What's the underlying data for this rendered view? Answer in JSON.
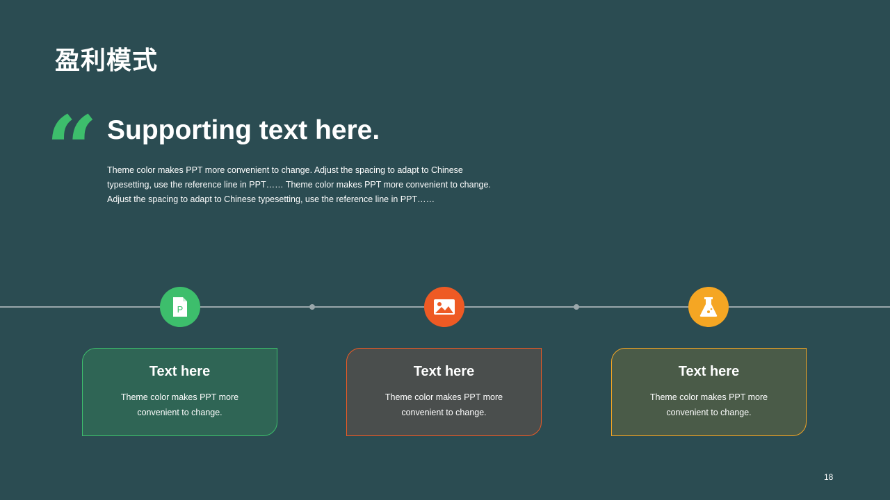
{
  "slide": {
    "title": "盈利模式",
    "quote_mark": "“",
    "headline": "Supporting text here.",
    "body": "Theme color makes PPT more convenient to change. Adjust the spacing to adapt to Chinese typesetting, use the reference line in PPT…… Theme color makes PPT more convenient to change. Adjust the spacing to adapt to Chinese typesetting, use the reference line in PPT……",
    "page_number": "18"
  },
  "timeline": {
    "items": [
      {
        "icon": "ppt-file-icon",
        "color": "#3DBE6C",
        "fill": "#2F6555",
        "title": "Text here",
        "text": "Theme color makes PPT more convenient to change."
      },
      {
        "icon": "image-icon",
        "color": "#EE5A24",
        "fill": "#4A4E4D",
        "title": "Text here",
        "text": "Theme color makes PPT more convenient to change."
      },
      {
        "icon": "flask-icon",
        "color": "#F5A623",
        "fill": "#4A5B48",
        "title": "Text here",
        "text": "Theme color makes PPT more convenient to change."
      }
    ]
  },
  "colors": {
    "background": "#2B4C52",
    "accent_green": "#3DBE6C",
    "accent_orange": "#EE5A24",
    "accent_yellow": "#F5A623"
  }
}
